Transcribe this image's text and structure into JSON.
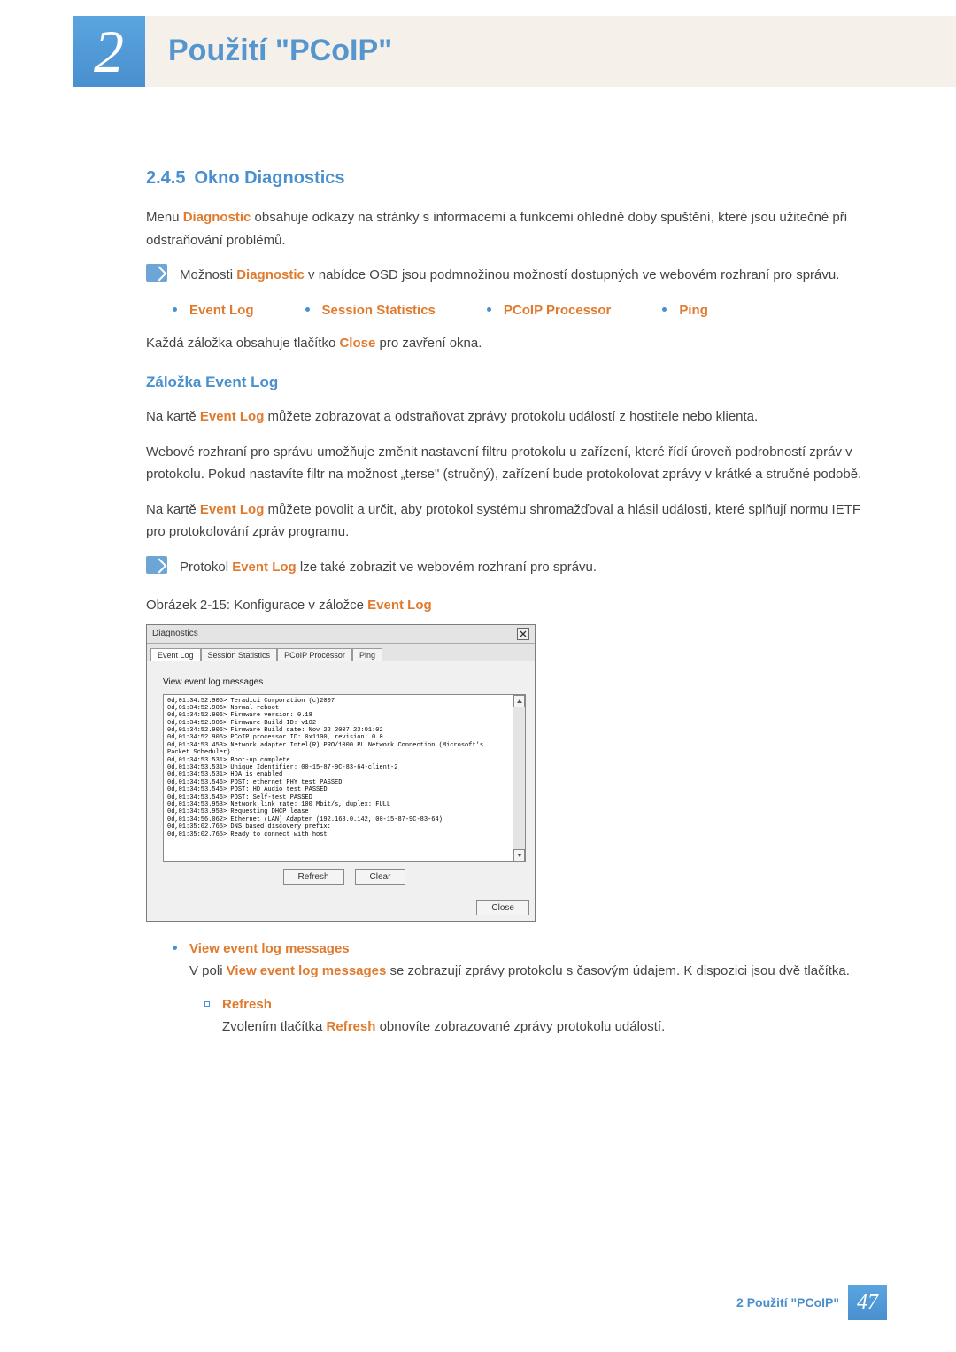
{
  "chapter": {
    "number": "2",
    "title": "Použití \"PCoIP\""
  },
  "section": {
    "number": "2.4.5",
    "title": "Okno Diagnostics"
  },
  "para1_pre": "Menu ",
  "para1_em": "Diagnostic",
  "para1_post": " obsahuje odkazy na stránky s informacemi a funkcemi ohledně doby spuštění, které jsou užitečné při odstraňování problémů.",
  "note1_pre": "Možnosti ",
  "note1_em": "Diagnostic",
  "note1_post": " v nabídce OSD jsou podmnožinou možností dostupných ve webovém rozhraní pro správu.",
  "tabs": [
    "Event Log",
    "Session Statistics",
    "PCoIP Processor",
    "Ping"
  ],
  "para2_pre": "Každá záložka obsahuje tlačítko ",
  "para2_em": "Close",
  "para2_post": " pro zavření okna.",
  "subhead1": "Záložka Event Log",
  "para3_pre": "Na kartě ",
  "para3_em": "Event Log",
  "para3_post": " můžete zobrazovat a odstraňovat zprávy protokolu událostí z hostitele nebo klienta.",
  "para4": "Webové rozhraní pro správu umožňuje změnit nastavení filtru protokolu u zařízení, které řídí úroveň podrobností zpráv v protokolu. Pokud nastavíte filtr na možnost „terse\" (stručný), zařízení bude protokolovat zprávy v krátké a stručné podobě.",
  "para5_pre": "Na kartě ",
  "para5_em": "Event Log",
  "para5_post": " můžete povolit a určit, aby protokol systému shromažďoval a hlásil události, které splňují normu IETF pro protokolování zpráv programu.",
  "note2_pre": "Protokol ",
  "note2_em": "Event Log",
  "note2_post": " lze také zobrazit ve webovém rozhraní pro správu.",
  "figcap_pre": "Obrázek 2-15: Konfigurace v záložce ",
  "figcap_em": "Event Log",
  "diag": {
    "title": "Diagnostics",
    "tabs": [
      "Event Log",
      "Session Statistics",
      "PCoIP Processor",
      "Ping"
    ],
    "view_label": "View event log messages",
    "log_lines": "0d,01:34:52.906> Teradici Corporation (c)2007\n0d,01:34:52.906> Normal reboot\n0d,01:34:52.906> Firmware version: 0.18\n0d,01:34:52.906> Firmware Build ID: v102\n0d,01:34:52.906> Firmware Build date: Nov 22 2007 23:01:02\n0d,01:34:52.906> PCoIP processor ID: 0x1100, revision: 0.0\n0d,01:34:53.453> Network adapter Intel(R) PRO/1000 PL Network Connection (Microsoft's\nPacket Scheduler)\n0d,01:34:53.531> Boot-up complete\n0d,01:34:53.531> Unique Identifier: 00-15-87-9C-83-64-client-2\n0d,01:34:53.531> HDA is enabled\n0d,01:34:53.546> POST: ethernet PHY test PASSED\n0d,01:34:53.546> POST: HD Audio test PASSED\n0d,01:34:53.546> POST: Self-test PASSED\n0d,01:34:53.953> Network link rate: 100 Mbit/s, duplex: FULL\n0d,01:34:53.953> Requesting DHCP lease\n0d,01:34:56.062> Ethernet (LAN) Adapter (192.168.0.142, 00-15-87-9C-83-64)\n0d,01:35:02.765> DNS based discovery prefix:\n0d,01:35:02.765> Ready to connect with host",
    "btn_refresh": "Refresh",
    "btn_clear": "Clear",
    "btn_close": "Close"
  },
  "bullet1_title": "View event log messages",
  "bullet1_pre": "V poli ",
  "bullet1_em": "View event log messages",
  "bullet1_post": " se zobrazují zprávy protokolu s časovým údajem. K dispozici jsou dvě tlačítka.",
  "sub1_title": "Refresh",
  "sub1_pre": "Zvolením tlačítka ",
  "sub1_em": "Refresh",
  "sub1_post": " obnovíte zobrazované zprávy protokolu událostí.",
  "footer": {
    "label": "2 Použití \"PCoIP\"",
    "page": "47"
  }
}
